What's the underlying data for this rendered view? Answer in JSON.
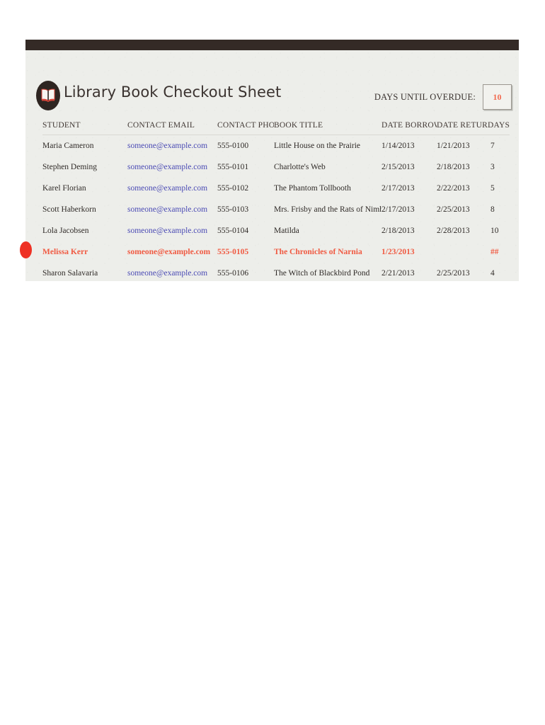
{
  "sheet": {
    "title": "Library Book Checkout Sheet",
    "logo_icon": "open-book-icon",
    "overdue": {
      "label": "DAYS UNTIL OVERDUE:",
      "value": "10",
      "value_color": "#f26a50"
    },
    "colors": {
      "topbar": "#342a26",
      "sheet_background": "#edeeea",
      "title_text": "#3b3330",
      "link": "#4a4ab4",
      "overdue_row": "#f05a42",
      "flag_marker": "#ee3124"
    },
    "flag_icon": "overdue-flag-icon"
  },
  "table": {
    "headers": [
      "STUDENT",
      "CONTACT EMAIL",
      "CONTACT PHON",
      "BOOK TITLE",
      "DATE BORROWI",
      "DATE RETURNE",
      "DAYS"
    ],
    "rows": [
      {
        "student": "Maria Cameron",
        "email": "someone@example.com",
        "phone": "555-0100",
        "book": "Little House on the Prairie",
        "borrowed": "1/14/2013",
        "returned": "1/21/2013",
        "days": "7",
        "overdue": false
      },
      {
        "student": "Stephen Deming",
        "email": "someone@example.com",
        "phone": "555-0101",
        "book": "Charlotte's Web",
        "borrowed": "2/15/2013",
        "returned": "2/18/2013",
        "days": "3",
        "overdue": false
      },
      {
        "student": "Karel Florian",
        "email": "someone@example.com",
        "phone": "555-0102",
        "book": "The Phantom Tollbooth",
        "borrowed": "2/17/2013",
        "returned": "2/22/2013",
        "days": "5",
        "overdue": false
      },
      {
        "student": "Scott Haberkorn",
        "email": "someone@example.com",
        "phone": "555-0103",
        "book": "Mrs. Frisby and the Rats of Nimh",
        "borrowed": "2/17/2013",
        "returned": "2/25/2013",
        "days": "8",
        "overdue": false
      },
      {
        "student": "Lola Jacobsen",
        "email": "someone@example.com",
        "phone": "555-0104",
        "book": "Matilda",
        "borrowed": "2/18/2013",
        "returned": "2/28/2013",
        "days": "10",
        "overdue": false
      },
      {
        "student": "Melissa Kerr",
        "email": "someone@example.com",
        "phone": "555-0105",
        "book": "The Chronicles of Narnia",
        "borrowed": "1/23/2013",
        "returned": "",
        "days": "##",
        "overdue": true
      },
      {
        "student": "Sharon Salavaria",
        "email": "someone@example.com",
        "phone": "555-0106",
        "book": "The Witch of Blackbird Pond",
        "borrowed": "2/21/2013",
        "returned": "2/25/2013",
        "days": "4",
        "overdue": false
      }
    ]
  }
}
